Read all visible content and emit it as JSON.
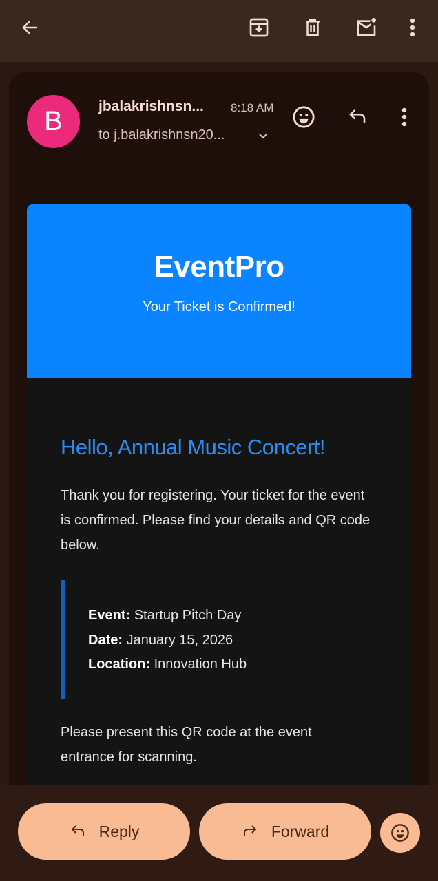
{
  "toolbar": {
    "back": "arrow-left-icon",
    "archive": "archive-icon",
    "delete": "trash-icon",
    "mark_unread": "mark-unread-icon",
    "more": "more-vert-icon"
  },
  "message": {
    "avatar_letter": "B",
    "sender": "jbalakrishnsn...",
    "time": "8:18 AM",
    "recipient": "to j.balakrishnsn20...",
    "avatar_color": "#ec2a7c"
  },
  "email": {
    "brand": "EventPro",
    "subtitle": "Your Ticket is Confirmed!",
    "greeting": "Hello, Annual Music Concert!",
    "intro": "Thank you for registering. Your ticket for the event is confirmed. Please find your details and QR code below.",
    "details": [
      {
        "label": "Event:",
        "value": "Startup Pitch Day"
      },
      {
        "label": "Date:",
        "value": "January 15, 2026"
      },
      {
        "label": "Location:",
        "value": "Innovation Hub"
      }
    ],
    "qr_note": "Please present this QR code at the event entrance for scanning.",
    "accent": "#0a84ff"
  },
  "actions": {
    "reply": "Reply",
    "forward": "Forward"
  }
}
